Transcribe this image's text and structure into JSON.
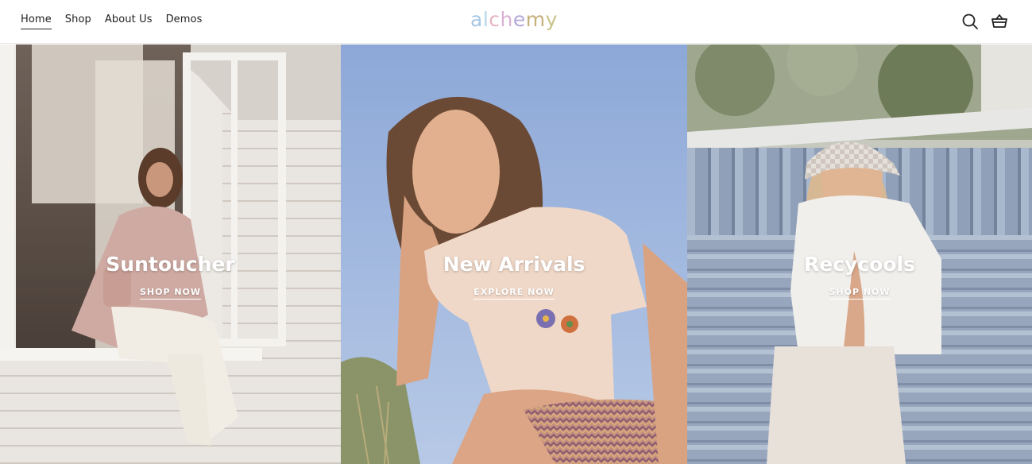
{
  "nav": {
    "items": [
      {
        "label": "Home",
        "active": true
      },
      {
        "label": "Shop"
      },
      {
        "label": "About Us"
      },
      {
        "label": "Demos"
      }
    ]
  },
  "logo": {
    "letters": [
      "a",
      "l",
      "c",
      "h",
      "e",
      "m",
      "y"
    ],
    "colors": [
      "#a9c7e3",
      "#b5d6ea",
      "#e7b4c0",
      "#d9b2d3",
      "#b6a8d9",
      "#c6b07d",
      "#c9c38a"
    ]
  },
  "icons": {
    "search": "search-icon",
    "cart": "basket-icon"
  },
  "panels": [
    {
      "title": "Suntoucher",
      "cta": "SHOP NOW"
    },
    {
      "title": "New Arrivals",
      "cta": "EXPLORE NOW"
    },
    {
      "title": "Recycools",
      "cta": "SHOP NOW"
    }
  ]
}
